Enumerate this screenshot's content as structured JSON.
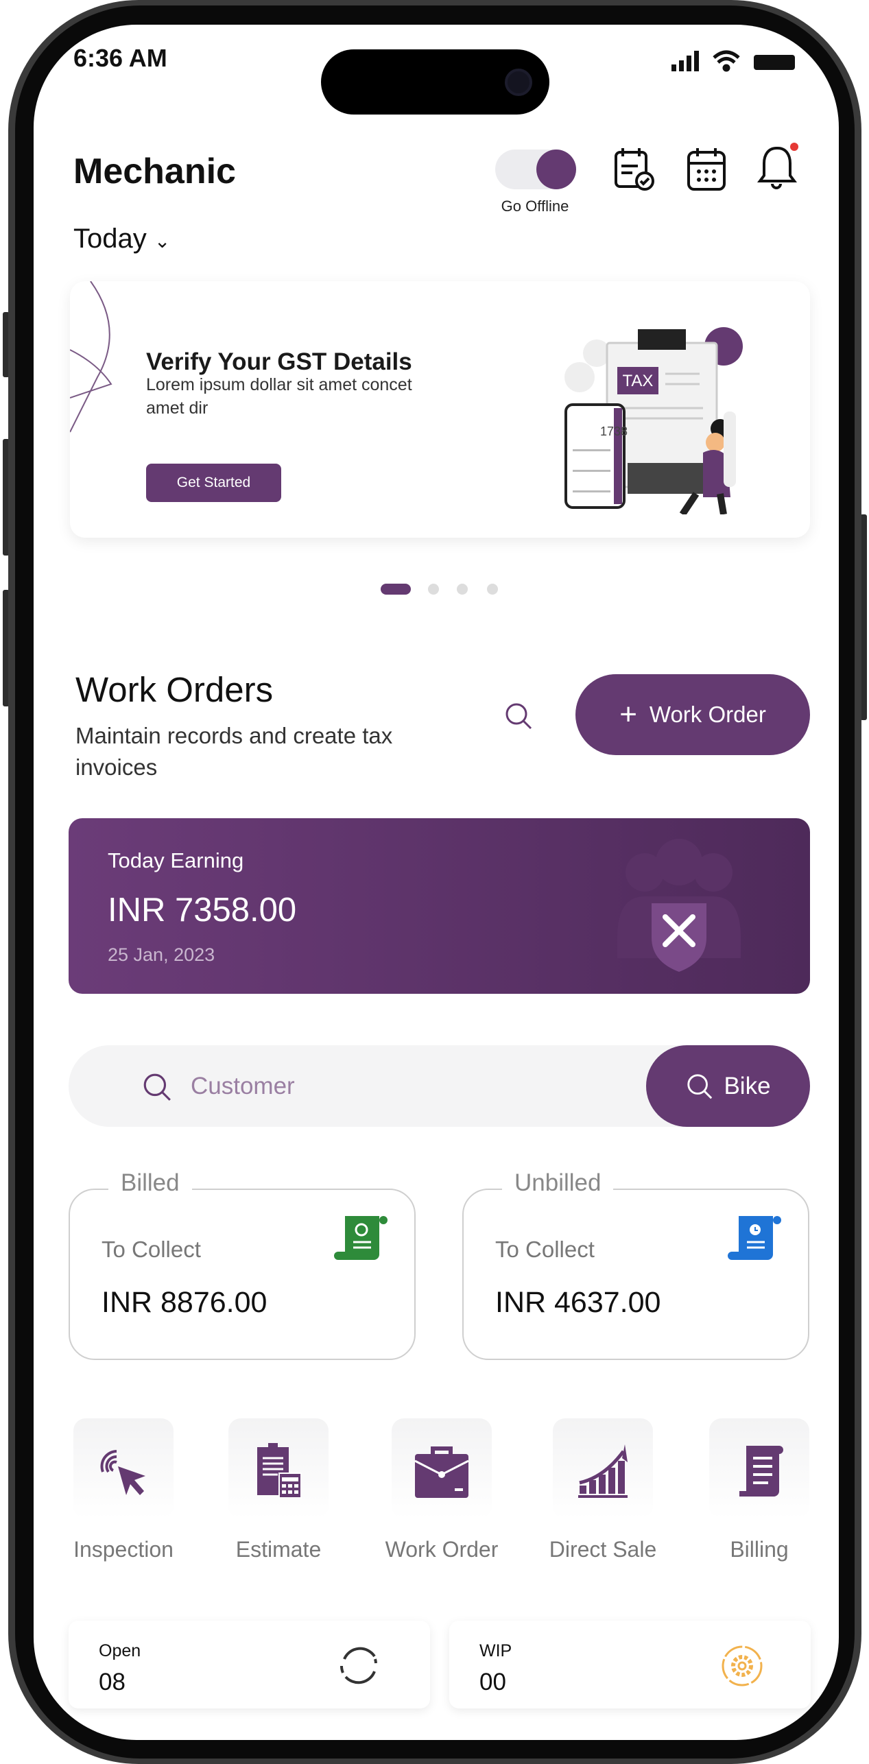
{
  "status_bar": {
    "time": "6:36 AM"
  },
  "header": {
    "title": "Mechanic",
    "toggle_label": "Go Offline",
    "toggle_on": true,
    "period": "Today",
    "icons": [
      "calendar-check-icon",
      "calendar-icon",
      "bell-icon"
    ]
  },
  "banner": {
    "title": "Verify Your GST Details",
    "body": "Lorem ipsum dollar sit amet concet amet dir",
    "button": "Get Started",
    "illustration_text": "TAX",
    "calc_display": "1738",
    "page_count": 4,
    "active_page": 1
  },
  "work_orders": {
    "title": "Work Orders",
    "subtitle": "Maintain records and create tax invoices",
    "add_button": "Work Order"
  },
  "earning": {
    "label": "Today Earning",
    "amount": "INR 7358.00",
    "date": "25 Jan, 2023"
  },
  "search": {
    "placeholder": "Customer",
    "filter_button": "Bike"
  },
  "billing": [
    {
      "legend": "Billed",
      "label": "To Collect",
      "amount": "INR 8876.00",
      "icon_color": "#2e8b3a"
    },
    {
      "legend": "Unbilled",
      "label": "To Collect",
      "amount": "INR 4637.00",
      "icon_color": "#1f74d6"
    }
  ],
  "quick_actions": [
    {
      "label": "Inspection",
      "icon": "touch-pointer-icon"
    },
    {
      "label": "Estimate",
      "icon": "estimate-calculator-icon"
    },
    {
      "label": "Work Order",
      "icon": "briefcase-icon"
    },
    {
      "label": "Direct Sale",
      "icon": "growth-chart-icon"
    },
    {
      "label": "Billing",
      "icon": "scroll-bill-icon"
    }
  ],
  "stats": [
    {
      "label": "Open",
      "value": "08",
      "icon": "refresh-icon"
    },
    {
      "label": "WIP",
      "value": "00",
      "icon": "gear-icon"
    }
  ],
  "colors": {
    "accent": "#643a71",
    "notification": "#e53935",
    "wip": "#f2b24d"
  }
}
